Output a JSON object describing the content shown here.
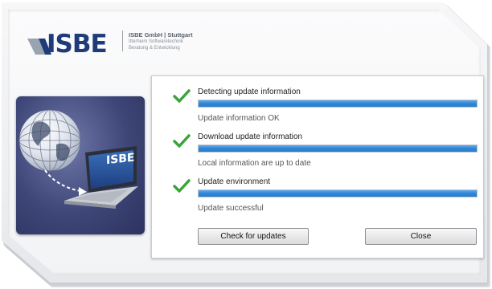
{
  "branding": {
    "logo_text": "ISBE",
    "company_name": "ISBE GmbH | Stuttgart",
    "company_lines": [
      "Itterheim Softwaretechnik",
      "Beratung & Entwicklung"
    ],
    "illustration_logo_text": "ISBE"
  },
  "steps": [
    {
      "title": "Detecting update information",
      "status": "Update information OK",
      "progress": 1.0
    },
    {
      "title": "Download update information",
      "status": "Local information are up to date",
      "progress": 1.0
    },
    {
      "title": "Update environment",
      "status": "Update successful",
      "progress": 1.0
    }
  ],
  "buttons": {
    "check_label": "Check for updates",
    "close_label": "Close"
  },
  "colors": {
    "progress": "#2f86d6",
    "check": "#3aa53a",
    "brand": "#1f3b7a"
  }
}
